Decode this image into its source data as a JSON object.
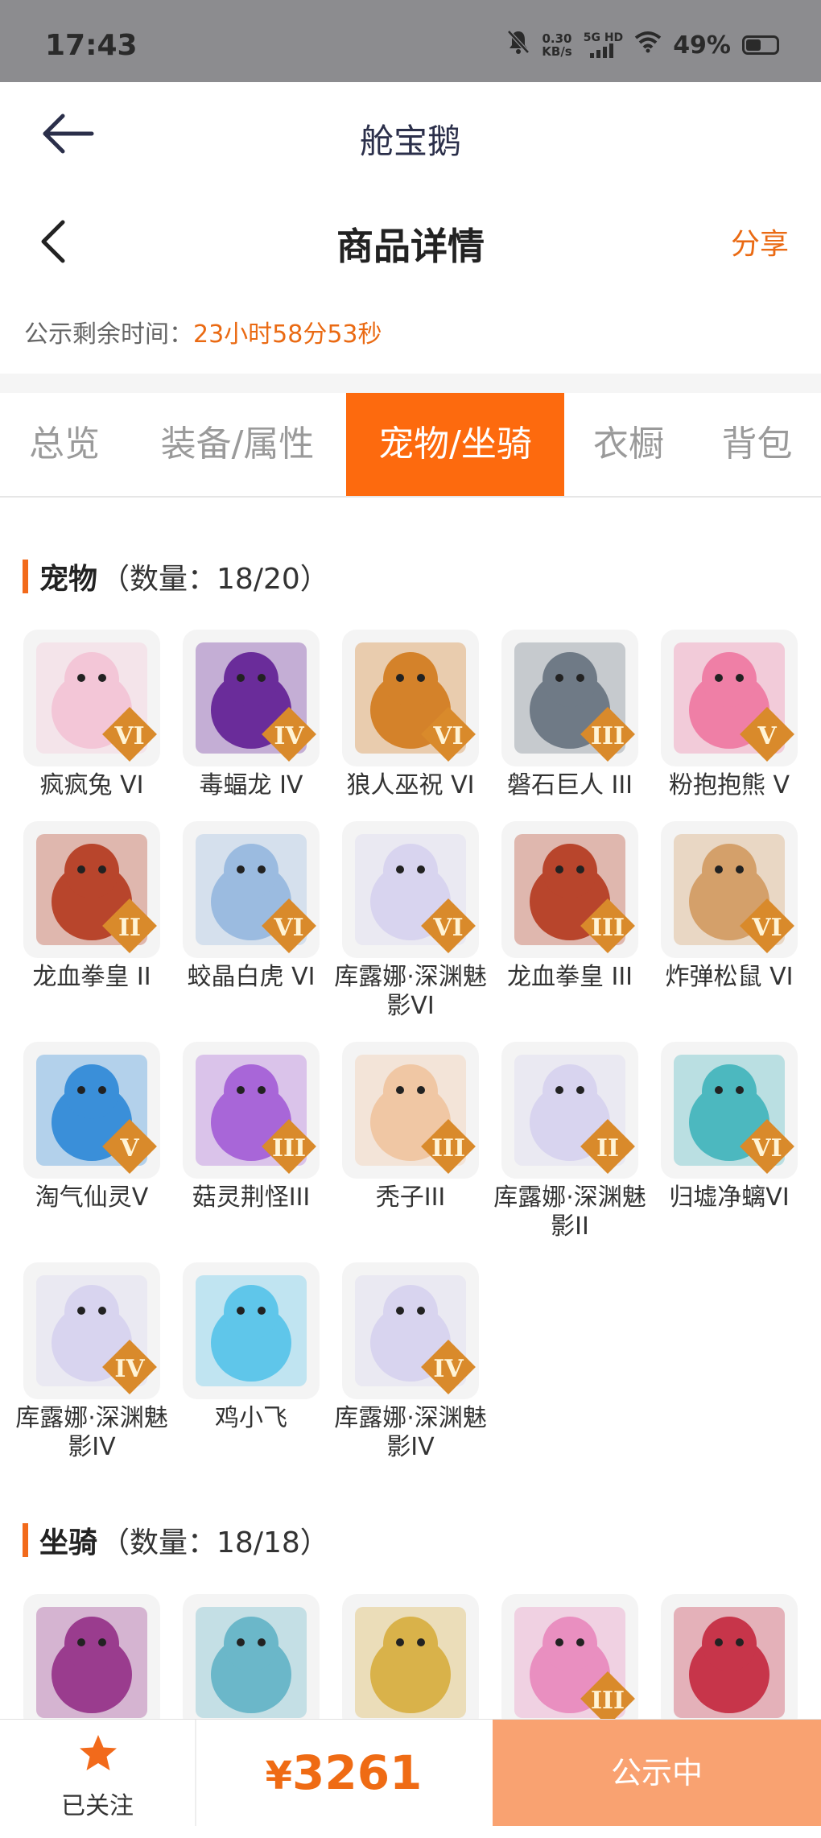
{
  "status_bar": {
    "time": "17:43",
    "net_speed_value": "0.30",
    "net_speed_unit": "KB/s",
    "network_label": "5G HD",
    "battery": "49%",
    "battery_level": 0.49
  },
  "app_header": {
    "title": "舱宝鹅"
  },
  "page_header": {
    "title": "商品详情",
    "share": "分享"
  },
  "timer": {
    "label": "公示剩余时间：",
    "value": "23小时58分53秒"
  },
  "tabs": [
    {
      "label": "总览",
      "active": false
    },
    {
      "label": "装备/属性",
      "active": false
    },
    {
      "label": "宠物/坐骑",
      "active": true
    },
    {
      "label": "衣橱",
      "active": false
    },
    {
      "label": "背包",
      "active": false
    }
  ],
  "pets_section": {
    "name": "宠物",
    "count": "（数量：18/20）"
  },
  "pets": [
    {
      "name": "疯疯兔 VI",
      "rank": "VI",
      "color": "#f3c6d7"
    },
    {
      "name": "毒蝠龙 IV",
      "rank": "IV",
      "color": "#6a2c9a"
    },
    {
      "name": "狼人巫祝 VI",
      "rank": "VI",
      "color": "#d4822a"
    },
    {
      "name": "磐石巨人 III",
      "rank": "III",
      "color": "#6f7a86"
    },
    {
      "name": "粉抱抱熊 V",
      "rank": "V",
      "color": "#ef7fa6"
    },
    {
      "name": "龙血拳皇 II",
      "rank": "II",
      "color": "#b8452c"
    },
    {
      "name": "蛟晶白虎 VI",
      "rank": "VI",
      "color": "#9bbbe0"
    },
    {
      "name": "库露娜·深渊魅影VI",
      "rank": "VI",
      "color": "#d8d4ef"
    },
    {
      "name": "龙血拳皇 III",
      "rank": "III",
      "color": "#b8452c"
    },
    {
      "name": "炸弹松鼠 VI",
      "rank": "VI",
      "color": "#d4a06a"
    },
    {
      "name": "淘气仙灵V",
      "rank": "V",
      "color": "#3a8fd9"
    },
    {
      "name": "菇灵荆怪III",
      "rank": "III",
      "color": "#a866d8"
    },
    {
      "name": "秃子III",
      "rank": "III",
      "color": "#f0c7a4"
    },
    {
      "name": "库露娜·深渊魅影II",
      "rank": "II",
      "color": "#d8d4ef"
    },
    {
      "name": "归墟净螭VI",
      "rank": "VI",
      "color": "#4cb8bf"
    },
    {
      "name": "库露娜·深渊魅影IV",
      "rank": "IV",
      "color": "#d8d4ef"
    },
    {
      "name": "鸡小飞",
      "rank": "",
      "color": "#5fc6ea"
    },
    {
      "name": "库露娜·深渊魅影IV",
      "rank": "IV",
      "color": "#d8d4ef"
    }
  ],
  "mounts_section": {
    "name": "坐骑",
    "count": "（数量：18/18）"
  },
  "mounts": [
    {
      "rank": "",
      "color": "#9a3c8e"
    },
    {
      "rank": "",
      "color": "#6bb7c9"
    },
    {
      "rank": "",
      "color": "#d9b24a"
    },
    {
      "rank": "III",
      "color": "#e98fc0"
    },
    {
      "rank": "",
      "color": "#c7354a"
    }
  ],
  "bottom_bar": {
    "follow_label": "已关注",
    "currency": "¥",
    "price": "3261",
    "status_button": "公示中"
  },
  "colors": {
    "accent": "#fd6a0e",
    "status_button_bg": "#f9a271",
    "price": "#ef6b14"
  }
}
